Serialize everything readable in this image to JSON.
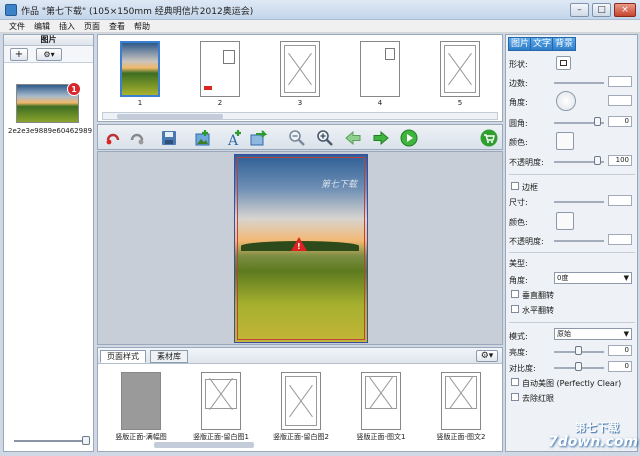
{
  "window": {
    "title": "作品 \"第七下载\" (105×150mm 经典明信片2012奥运会)",
    "buttons": {
      "minimize": "–",
      "maximize": "□",
      "close": "×"
    }
  },
  "menu": [
    "文件",
    "编辑",
    "插入",
    "页面",
    "查看",
    "帮助"
  ],
  "left_panel": {
    "header": "图片",
    "add_label": "+",
    "gear_label": "⚙▾",
    "badge": "1",
    "caption": "2e2e3e9889e604629897..."
  },
  "page_strip": {
    "pages": [
      "1",
      "2",
      "3",
      "4",
      "5"
    ]
  },
  "toolbar": {
    "icons": [
      "undo-icon",
      "redo-icon",
      "save-icon",
      "add-image-icon",
      "add-text-icon",
      "replace-icon",
      "zoom-out-icon",
      "zoom-in-icon",
      "prev-icon",
      "next-icon",
      "play-icon",
      "cart-icon"
    ]
  },
  "canvas": {
    "watermark": "第七下载",
    "warning": "!"
  },
  "bottom_panel": {
    "tabs": [
      "页面样式",
      "素材库"
    ],
    "gear_label": "⚙▾",
    "items": [
      "竖版正面-满幅图",
      "竖版正面-留白图1",
      "竖版正面-留白图2",
      "竖版正面-图文1",
      "竖版正面-图文2"
    ]
  },
  "right_panel": {
    "tabs": [
      "图片",
      "文字",
      "背景"
    ],
    "shape_label": "形状:",
    "corner_label": "边数:",
    "angle_label": "角度:",
    "round_label": "圆角:",
    "round_value": "0",
    "color_label": "颜色:",
    "opacity_label": "不透明度:",
    "opacity_value": "100",
    "border_check": "边框",
    "size_label": "尺寸:",
    "border_color_label": "颜色:",
    "border_opacity_label": "不透明度:",
    "effect_label": "美型:",
    "rotate_label": "角度:",
    "rotate_value": "0度",
    "flip_v": "垂直翻转",
    "flip_h": "水平翻转",
    "mode_label": "模式:",
    "mode_value": "原始",
    "brightness_label": "亮度:",
    "brightness_value": "0",
    "contrast_label": "对比度:",
    "contrast_value": "0",
    "auto_beautify": "自动美图 (Perfectly Clear)",
    "red_eye": "去除红眼"
  },
  "brand": {
    "name": "第七下载",
    "domain": "7down.com"
  }
}
